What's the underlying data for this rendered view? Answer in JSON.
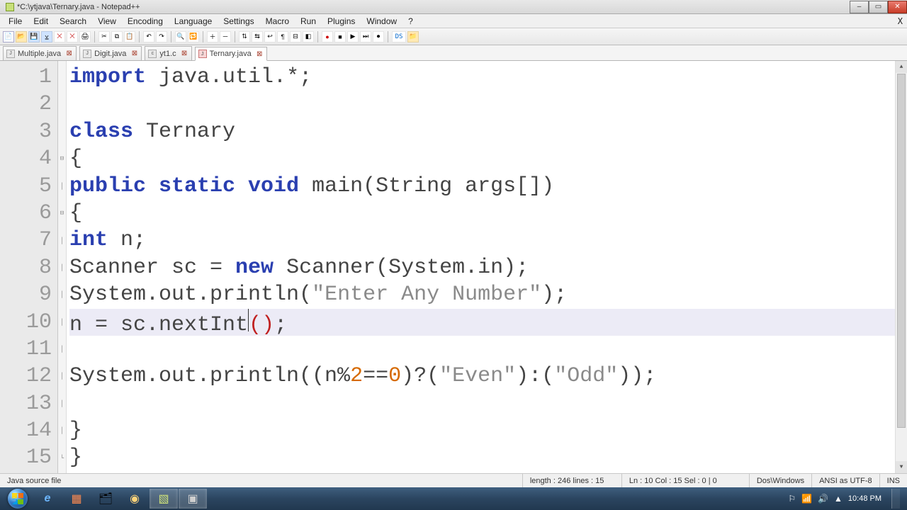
{
  "window": {
    "title": "*C:\\ytjava\\Ternary.java - Notepad++"
  },
  "menu": {
    "file": "File",
    "edit": "Edit",
    "search": "Search",
    "view": "View",
    "encoding": "Encoding",
    "language": "Language",
    "settings": "Settings",
    "macro": "Macro",
    "run": "Run",
    "plugins": "Plugins",
    "window": "Window",
    "help": "?",
    "closeX": "X"
  },
  "tabs": [
    {
      "label": "Multiple.java",
      "active": false
    },
    {
      "label": "Digit.java",
      "active": false
    },
    {
      "label": "yt1.c",
      "active": false
    },
    {
      "label": "Ternary.java",
      "active": true
    }
  ],
  "lines": [
    "1",
    "2",
    "3",
    "4",
    "5",
    "6",
    "7",
    "8",
    "9",
    "10",
    "11",
    "12",
    "13",
    "14",
    "15"
  ],
  "code": {
    "l1_import": "import",
    "l1_rest": " java.util.*;",
    "l3_class": "class",
    "l3_name": " Ternary",
    "l4": "{",
    "l5_kw": "public static void",
    "l5_main": " main",
    "l5_sig": "(String args[])",
    "l6": "{",
    "l7_int": "int",
    "l7_rest": " n;",
    "l8_a": "Scanner sc = ",
    "l8_new": "new",
    "l8_b": " Scanner(System.in);",
    "l9_a": "System.out.println(",
    "l9_str": "\"Enter Any Number\"",
    "l9_b": ");",
    "l10_a": "n = sc.nextInt",
    "l10_par_o": "(",
    "l10_par_c": ")",
    "l10_semi": ";",
    "l12_a": "System.out.println((n%",
    "l12_n2": "2",
    "l12_eq": "==",
    "l12_n0": "0",
    "l12_b": ")?(",
    "l12_s1": "\"Even\"",
    "l12_c": "):(",
    "l12_s2": "\"Odd\"",
    "l12_d": "));",
    "l14": "}",
    "l15": "}"
  },
  "status": {
    "filetype": "Java source file",
    "length": "length : 246    lines : 15",
    "pos": "Ln : 10    Col : 15    Sel : 0 | 0",
    "eol": "Dos\\Windows",
    "enc": "ANSI as UTF-8",
    "ins": "INS"
  },
  "taskbar": {
    "time": "10:48 PM",
    "date": "■",
    "icons": {
      "ie": "e",
      "pp": "▦",
      "folder": "📁",
      "chrome": "◯",
      "npp": "▢",
      "term": "▣"
    }
  },
  "tray": {
    "flag": "▚",
    "net": "▮",
    "vol": "🔊",
    "bat": "▲"
  }
}
